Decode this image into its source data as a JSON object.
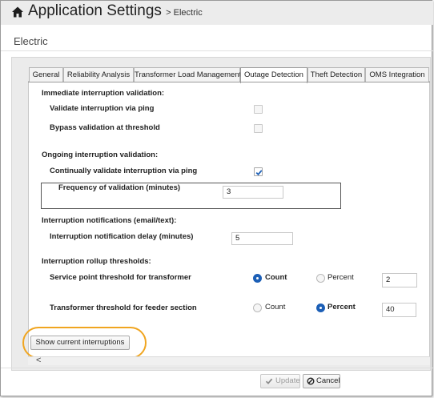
{
  "header": {
    "app_title": "Application Settings",
    "breadcrumb": "> Electric"
  },
  "page_title": "Electric",
  "tabs": [
    {
      "label": "General",
      "active": false
    },
    {
      "label": "Reliability Analysis",
      "active": false
    },
    {
      "label": "Transformer Load Management",
      "active": false
    },
    {
      "label": "Outage Detection",
      "active": true
    },
    {
      "label": "Theft Detection",
      "active": false
    },
    {
      "label": "OMS Integration",
      "active": false
    }
  ],
  "immediate": {
    "heading": "Immediate interruption validation:",
    "validate_ping_label": "Validate interruption via ping",
    "validate_ping_checked": false,
    "bypass_label": "Bypass validation at threshold",
    "bypass_checked": false
  },
  "ongoing": {
    "heading": "Ongoing interruption validation:",
    "continual_label": "Continually validate interruption via ping",
    "continual_checked": true,
    "frequency_label": "Frequency of validation (minutes)",
    "frequency_value": "3"
  },
  "notifications": {
    "heading": "Interruption notifications (email/text):",
    "delay_label": "Interruption notification delay (minutes)",
    "delay_value": "5"
  },
  "rollup": {
    "heading": "Interruption rollup thresholds:",
    "service_point_label": "Service point threshold for transformer",
    "service_point_mode": "Count",
    "service_point_value": "2",
    "transformer_label": "Transformer threshold for feeder section",
    "transformer_mode": "Percent",
    "transformer_value": "40",
    "count_label": "Count",
    "percent_label": "Percent"
  },
  "show_interruptions_label": "Show current interruptions",
  "scroll_left_glyph": "<",
  "footer": {
    "update_label": "Update",
    "cancel_label": "Cancel"
  },
  "colors": {
    "accent": "#1c5fb6",
    "highlight": "#f0a520"
  }
}
